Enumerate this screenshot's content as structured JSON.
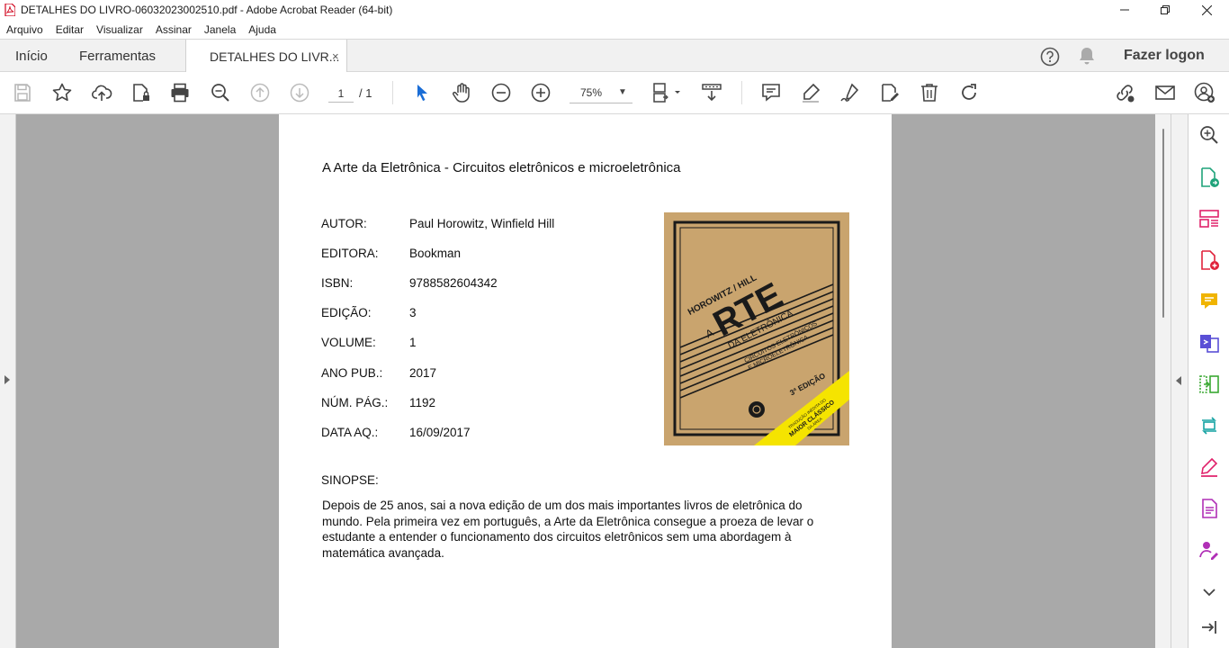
{
  "window": {
    "title": "DETALHES DO LIVRO-06032023002510.pdf - Adobe Acrobat Reader (64-bit)"
  },
  "menu": [
    "Arquivo",
    "Editar",
    "Visualizar",
    "Assinar",
    "Janela",
    "Ajuda"
  ],
  "tabs": {
    "home": "Início",
    "tools": "Ferramentas",
    "document": "DETALHES DO LIVR...",
    "close_glyph": "×"
  },
  "account": {
    "login_label": "Fazer logon"
  },
  "toolbar": {
    "current_page": "1",
    "total_pages": "/ 1",
    "zoom": "75%"
  },
  "document": {
    "title": "A Arte da Eletrônica - Circuitos eletrônicos e microeletrônica",
    "fields": [
      {
        "label": "AUTOR:",
        "value": "Paul Horowitz, Winfield Hill"
      },
      {
        "label": "EDITORA:",
        "value": "Bookman"
      },
      {
        "label": "ISBN:",
        "value": "9788582604342"
      },
      {
        "label": "EDIÇÃO:",
        "value": "3"
      },
      {
        "label": "VOLUME:",
        "value": "1"
      },
      {
        "label": "ANO PUB.:",
        "value": "2017"
      },
      {
        "label": "NÚM. PÁG.:",
        "value": "1192"
      },
      {
        "label": "DATA AQ.:",
        "value": "16/09/2017"
      }
    ],
    "synopsis_label": "SINOPSE:",
    "synopsis": "Depois de 25 anos, sai a nova edição de um dos mais importantes livros de eletrônica do mundo. Pela primeira vez em português, a Arte da Eletrônica consegue a proeza de levar o estudante a entender o funcionamento dos circuitos eletrônicos sem uma abordagem à matemática avançada.",
    "cover": {
      "authors": "HOROWITZ / HILL",
      "title_small": "A",
      "title_big": "RTE",
      "subtitle": "DA ELETRÔNICA",
      "tagline1": "CIRCUITOS ELETRÔNICOS",
      "tagline2": "E MICROELETRÔNICA",
      "edition": "3ª EDIÇÃO",
      "banner_small": "TRADUÇÃO INÉDITA DO",
      "banner_big": "MAIOR CLÁSSICO",
      "banner_small2": "DA ÁREA"
    }
  },
  "icons": {
    "toolbar": [
      "save-icon",
      "bookmark-star-icon",
      "upload-cloud-icon",
      "file-lock-icon",
      "print-icon",
      "zoom-find-icon",
      "page-up-icon",
      "page-down-icon",
      "select-cursor-icon",
      "hand-pan-icon",
      "zoom-out-icon",
      "zoom-in-icon",
      "fit-page-icon",
      "scroll-mode-icon",
      "comment-icon",
      "highlight-pen-icon",
      "sign-pen-icon",
      "edit-export-icon",
      "trash-icon",
      "rotate-icon",
      "share-link-icon",
      "email-icon",
      "add-user-icon"
    ],
    "right_pane": [
      "zoom-search-icon",
      "export-pdf-icon",
      "organize-pages-icon",
      "create-pdf-icon",
      "comment-icon",
      "combine-files-icon",
      "compress-icon",
      "convert-icon",
      "fill-sign-icon",
      "edit-pdf-icon",
      "request-signature-icon",
      "more-tools-icon",
      "collapse-pane-icon"
    ]
  },
  "colors": {
    "viewer_bg": "#a9a9a9",
    "accent_blue": "#1a6dd6",
    "acrobat_red": "#d0021b",
    "cover_tan": "#c9a46e",
    "cover_yellow": "#f5e400"
  }
}
